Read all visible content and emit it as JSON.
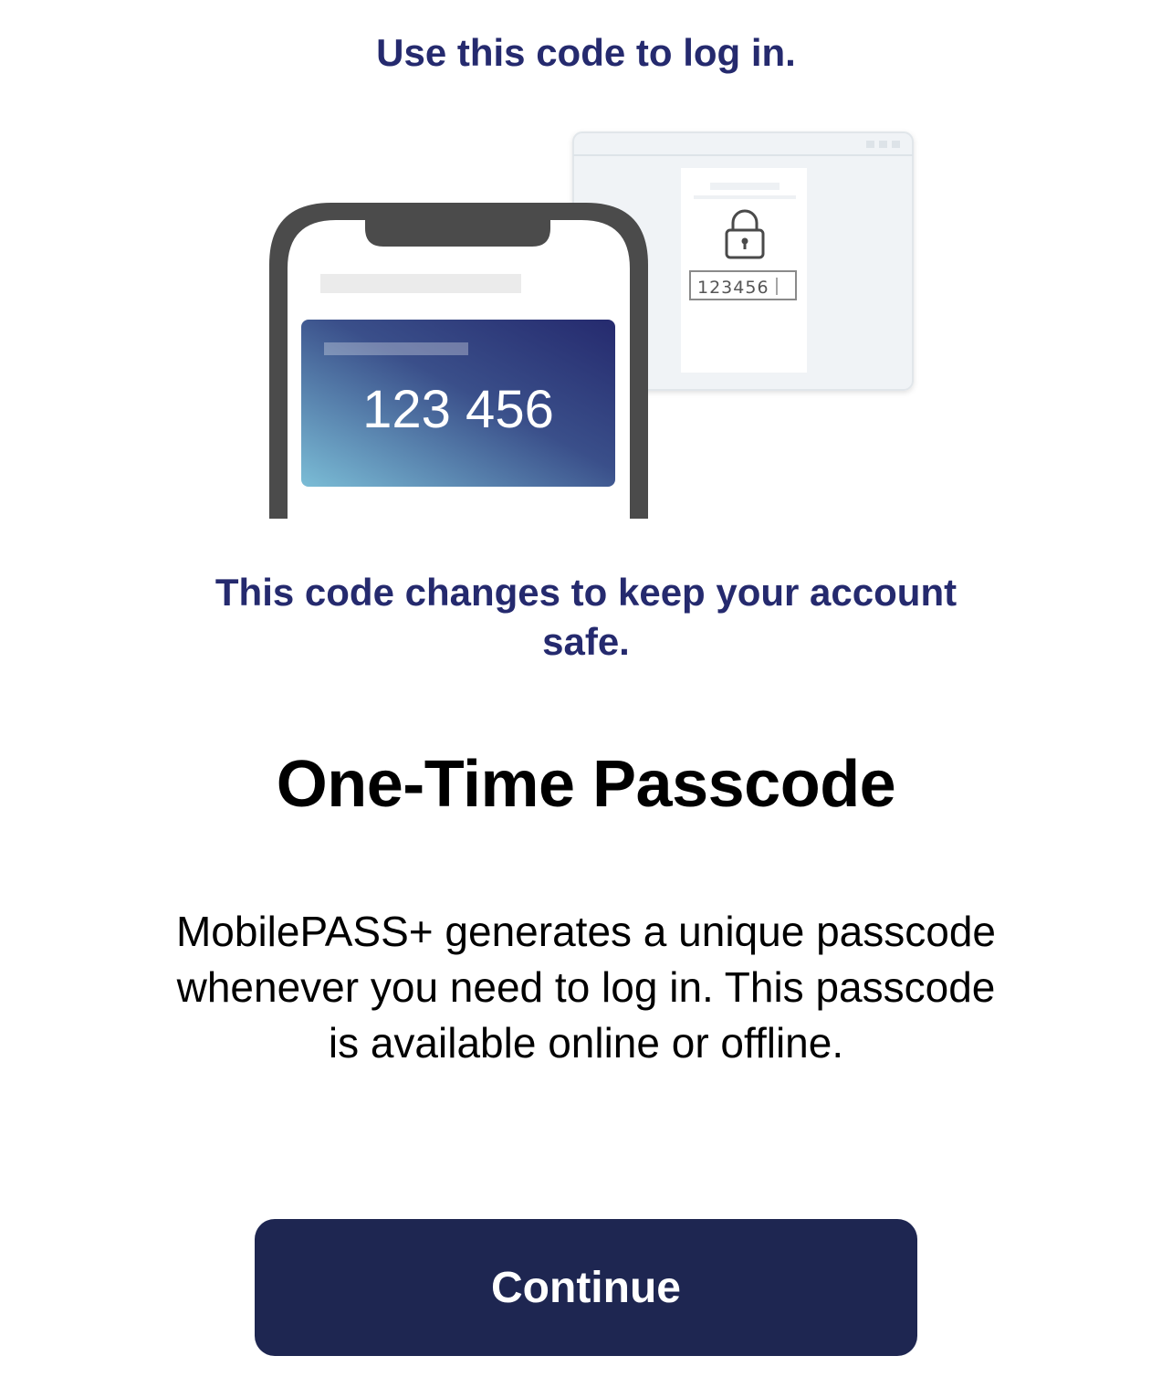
{
  "onboarding": {
    "caption_top": "Use this code to log in.",
    "illustration": {
      "phone_code": "123 456",
      "browser_field_value": "123456",
      "icon": "lock-icon"
    },
    "caption_mid": "This code changes to keep your account safe.",
    "title": "One-Time Passcode",
    "description": "MobilePASS+ generates a unique passcode whenever you need to log in. This passcode is available online or offline.",
    "continue_label": "Continue"
  },
  "colors": {
    "accent_text": "#252a6e",
    "button_bg": "#1e2651",
    "card_gradient_start": "#7bbdd6",
    "card_gradient_end": "#252a6e"
  }
}
